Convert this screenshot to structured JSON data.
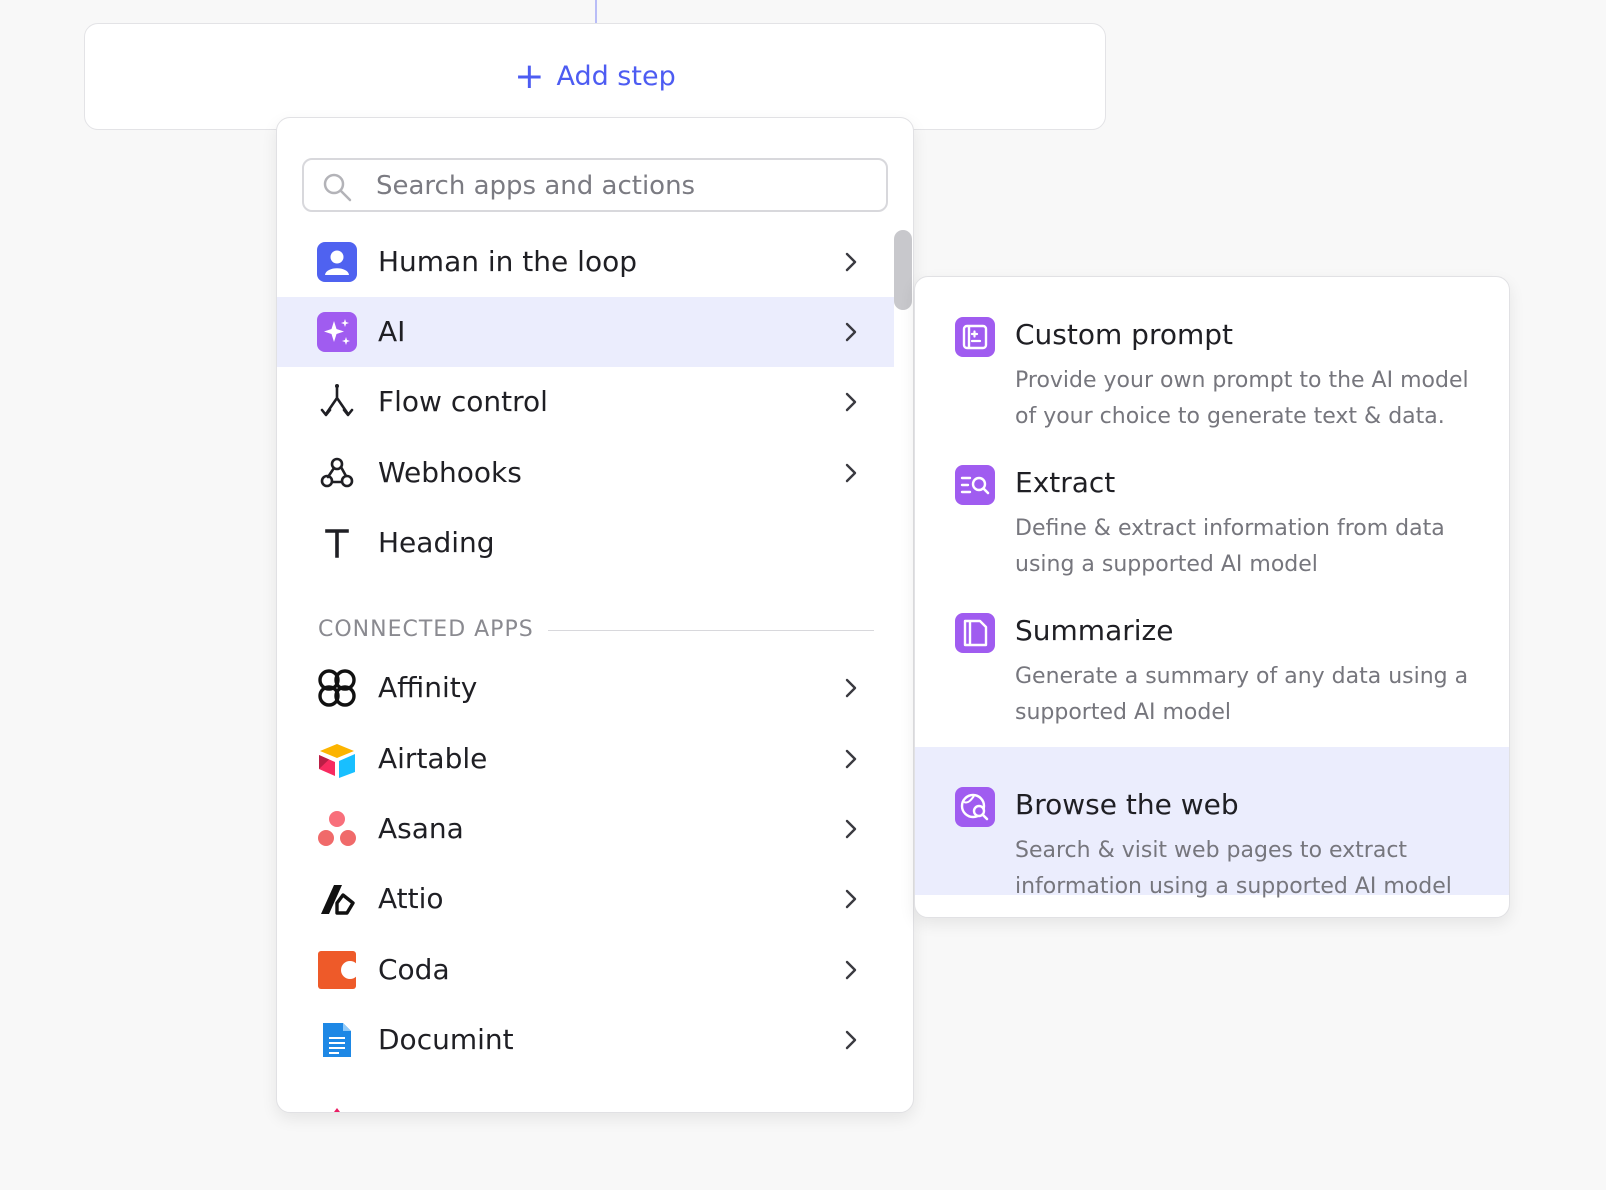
{
  "add_step": {
    "label": "Add step"
  },
  "search": {
    "placeholder": "Search apps and actions"
  },
  "menu": {
    "items": [
      {
        "label": "Human in the loop"
      },
      {
        "label": "AI"
      },
      {
        "label": "Flow control"
      },
      {
        "label": "Webhooks"
      },
      {
        "label": "Heading"
      }
    ],
    "section_label": "CONNECTED APPS",
    "apps": [
      {
        "label": "Affinity"
      },
      {
        "label": "Airtable"
      },
      {
        "label": "Asana"
      },
      {
        "label": "Attio"
      },
      {
        "label": "Coda"
      },
      {
        "label": "Documint"
      }
    ]
  },
  "submenu": {
    "options": [
      {
        "title": "Custom prompt",
        "description": "Provide your own prompt to the AI model of your choice to generate text & data."
      },
      {
        "title": "Extract",
        "description": "Define & extract information from data using a supported AI model"
      },
      {
        "title": "Summarize",
        "description": "Generate a summary of any data using a supported AI model"
      },
      {
        "title": "Browse the web",
        "description": "Search & visit web pages to extract information using a supported AI model"
      }
    ]
  },
  "colors": {
    "accent": "#4d5cf2",
    "active_row": "#ebedfd",
    "ai_purple": "#9b5cf2"
  },
  "icons": {
    "human_in_the_loop": "person-icon",
    "ai": "sparkle-icon",
    "flow_control": "flow-branch-icon",
    "webhooks": "webhook-icon",
    "heading": "text-t-icon",
    "custom_prompt": "prompt-icon",
    "extract": "extract-icon",
    "summarize": "document-icon",
    "browse_the_web": "globe-search-icon"
  }
}
